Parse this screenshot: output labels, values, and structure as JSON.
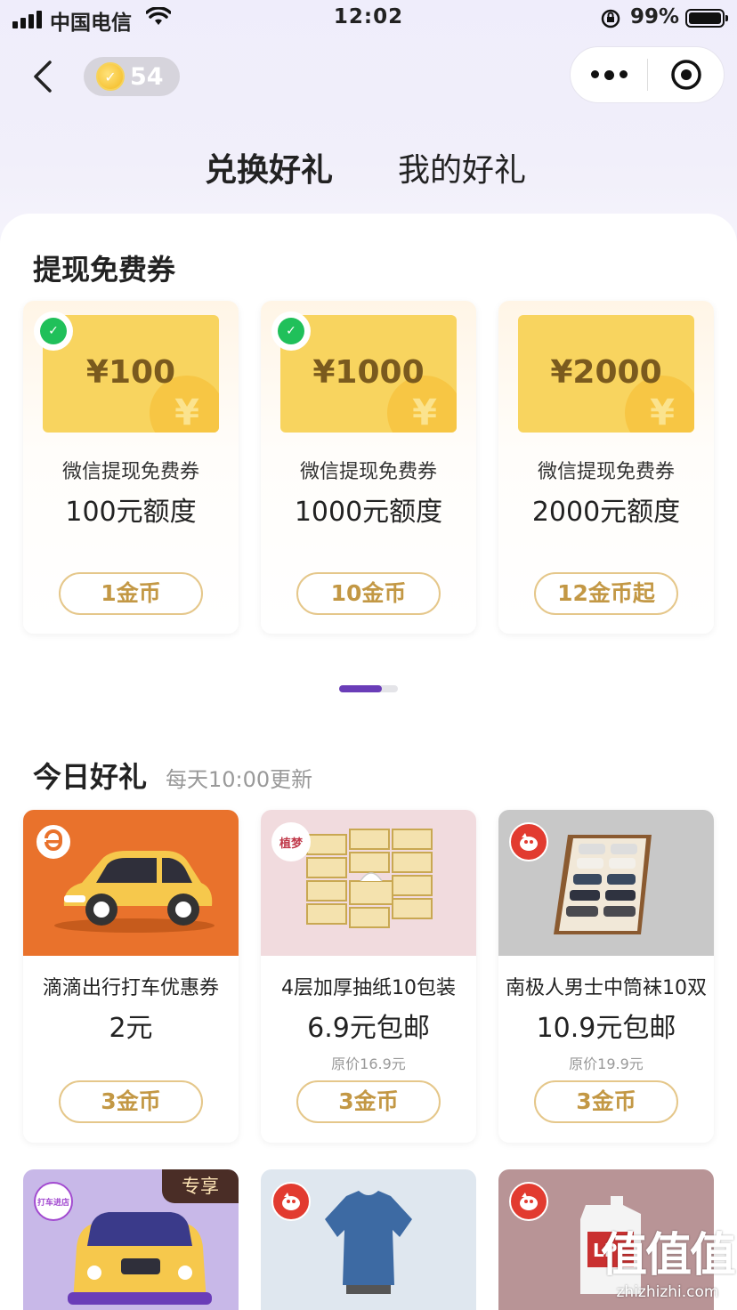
{
  "status_bar": {
    "carrier": "中国电信",
    "time": "12:02",
    "battery": "99%"
  },
  "header": {
    "coin_count": "54"
  },
  "tabs": [
    {
      "label": "兑换好礼"
    },
    {
      "label": "我的好礼"
    }
  ],
  "withdraw_section": {
    "title": "提现免费券",
    "vouchers": [
      {
        "amount": "¥100",
        "name": "微信提现免费券",
        "limit": "100元额度",
        "price": "1金币"
      },
      {
        "amount": "¥1000",
        "name": "微信提现免费券",
        "limit": "1000元额度",
        "price": "10金币"
      },
      {
        "amount": "¥2000",
        "name": "微信提现免费券",
        "limit": "2000元额度",
        "price": "12金币起"
      }
    ],
    "ticket_symbol": "¥"
  },
  "today_section": {
    "title": "今日好礼",
    "subtitle": "每天10:00更新",
    "gifts": [
      {
        "name": "滴滴出行打车优惠券",
        "price": "2元",
        "original": "",
        "cost": "3金币"
      },
      {
        "name": "4层加厚抽纸10包装",
        "price": "6.9元包邮",
        "original": "原价16.9元",
        "cost": "3金币",
        "brand_label": "植梦"
      },
      {
        "name": "南极人男士中筒袜10双",
        "price": "10.9元包邮",
        "original": "原价19.9元",
        "cost": "3金币"
      }
    ],
    "next_row": [
      {
        "badge": "专享",
        "brand_label": "打车进店"
      },
      {},
      {
        "product_label": "LP"
      }
    ]
  },
  "watermark": {
    "big": "值值值",
    "small": "zhizhizhi.com"
  }
}
